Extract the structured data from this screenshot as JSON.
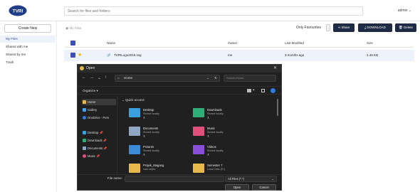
{
  "header": {
    "logo_text": "TVRI",
    "search_placeholder": "Search for files and folders",
    "user_menu": "admin"
  },
  "sidebar": {
    "create_label": "Create New",
    "items": [
      {
        "label": "My Files",
        "active": true
      },
      {
        "label": "Shared with me",
        "active": false
      },
      {
        "label": "Shared by me",
        "active": false
      },
      {
        "label": "Trash",
        "active": false
      }
    ]
  },
  "main": {
    "breadcrumb": "My Files",
    "only_favourites_label": "Only Favourites",
    "actions": {
      "share": "Share",
      "download": "DOWNLOAD",
      "delete": "Delete"
    },
    "columns": [
      "Name",
      "Owner",
      "Last Modified",
      "Size"
    ],
    "rows": [
      {
        "name": "TVRILogo2019.svg",
        "owner": "me",
        "modified": "3 months ago",
        "size": "1.46 KB",
        "favourite": true,
        "selected": true
      }
    ]
  },
  "dialog": {
    "title": "Open",
    "address": "Home",
    "search_placeholder": "Search Home",
    "organize_label": "Organize",
    "nav_items": [
      {
        "label": "Home",
        "icon": "home-icon",
        "selected": true
      },
      {
        "label": "Gallery",
        "icon": "gallery-icon",
        "selected": false
      },
      {
        "label": "OneDrive - Pers",
        "icon": "cloud-icon",
        "selected": false
      },
      {
        "label": "Desktop",
        "icon": "desktop-icon",
        "selected": false
      },
      {
        "label": "Downloads",
        "icon": "download-icon",
        "selected": false
      },
      {
        "label": "Documents",
        "icon": "document-icon",
        "selected": false
      },
      {
        "label": "Music",
        "icon": "music-icon",
        "selected": false
      }
    ],
    "quick_access_label": "Quick access",
    "folders": [
      {
        "name": "Desktop",
        "sub": "Stored locally",
        "color": "#3aa0e0"
      },
      {
        "name": "Downloads",
        "sub": "Stored locally",
        "color": "#2fae7a"
      },
      {
        "name": "Documents",
        "sub": "Stored locally",
        "color": "#8fa7c0"
      },
      {
        "name": "Music",
        "sub": "Stored locally",
        "color": "#e0507a"
      },
      {
        "name": "Pictures",
        "sub": "Stored locally",
        "color": "#3d8ad8"
      },
      {
        "name": "Videos",
        "sub": "Stored locally",
        "color": "#8a4fd8"
      },
      {
        "name": "Projek_Magang",
        "sub": "ivan septo",
        "color": "#e8b84a"
      },
      {
        "name": "Semester 7",
        "sub": "Local Disk (D:)",
        "color": "#e8b84a"
      }
    ],
    "file_name_label": "File name:",
    "file_type": "All Files (*.*)",
    "open_label": "Open",
    "cancel_label": "Cancel"
  }
}
